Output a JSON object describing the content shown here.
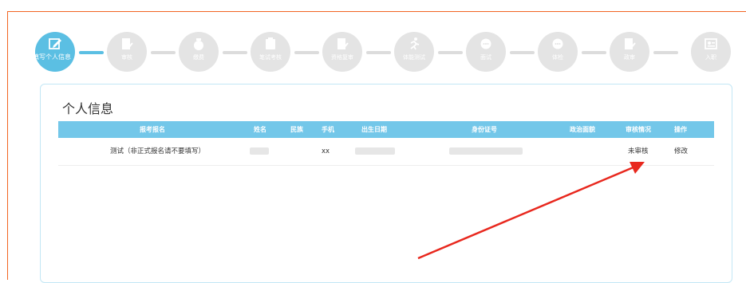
{
  "steps": [
    {
      "label": "填写个人信息",
      "icon": "edit-icon"
    },
    {
      "label": "审核",
      "icon": "document-check-icon"
    },
    {
      "label": "缴费",
      "icon": "money-bag-icon"
    },
    {
      "label": "笔试考核",
      "icon": "clipboard-icon"
    },
    {
      "label": "资格复审",
      "icon": "document-check-icon"
    },
    {
      "label": "体能测试",
      "icon": "running-icon"
    },
    {
      "label": "面试",
      "icon": "chat-bubble-icon"
    },
    {
      "label": "体检",
      "icon": "chat-bubble-icon"
    },
    {
      "label": "政审",
      "icon": "document-check-icon"
    },
    {
      "label": "入职",
      "icon": "id-card-icon"
    }
  ],
  "panel": {
    "title": "个人信息",
    "columns": {
      "exam_name": "报考报名",
      "name": "姓名",
      "ethnicity": "民族",
      "phone": "手机",
      "birth": "出生日期",
      "id_number": "身份证号",
      "political": "政治面貌",
      "review_status": "审核情况",
      "action": "操作"
    },
    "row": {
      "exam_name": "测试（非正式报名请不要填写）",
      "name": "",
      "ethnicity": "",
      "phone": "xx",
      "birth": "",
      "id_number": "",
      "political": "",
      "review_status": "未审核",
      "action": "修改"
    }
  },
  "colors": {
    "accent": "#5bbfe3",
    "header": "#73c7e9",
    "inactive_step": "#e4e4e4",
    "frame": "#f26522",
    "arrow": "#e8281e"
  }
}
